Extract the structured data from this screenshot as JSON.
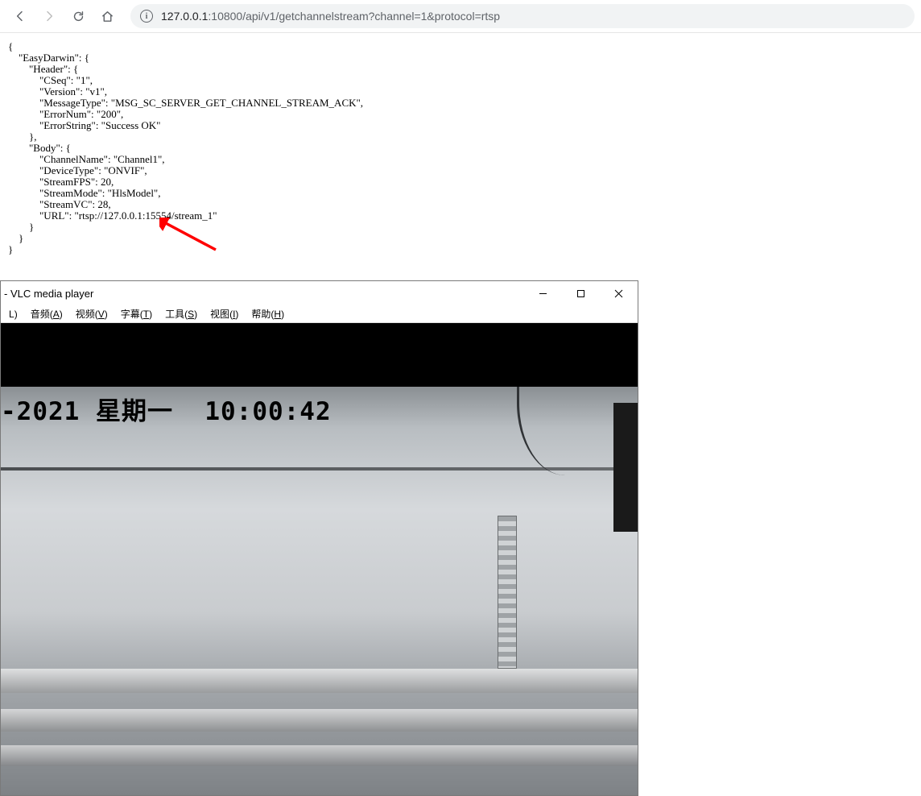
{
  "browser": {
    "url_host": "127.0.0.1",
    "url_port_path": ":10800/api/v1/getchannelstream?channel=1&protocol=rtsp"
  },
  "api_response": {
    "EasyDarwin": {
      "Header": {
        "CSeq": "1",
        "Version": "v1",
        "MessageType": "MSG_SC_SERVER_GET_CHANNEL_STREAM_ACK",
        "ErrorNum": "200",
        "ErrorString": "Success OK"
      },
      "Body": {
        "ChannelName": "Channel1",
        "DeviceType": "ONVIF",
        "StreamFPS": 20,
        "StreamMode": "HlsModel",
        "StreamVC": 28,
        "URL": "rtsp://127.0.0.1:15554/stream_1"
      }
    }
  },
  "vlc": {
    "title": " - VLC media player",
    "menu": {
      "l": "L",
      "audio": "音频(A)",
      "video": "视频(V)",
      "subtitle": "字幕(T)",
      "tools": "工具(S)",
      "view": "视图(I)",
      "help": "帮助(H)"
    },
    "osd": {
      "date_part": "-2021",
      "weekday": "星期一",
      "time": "10:00:42"
    }
  }
}
